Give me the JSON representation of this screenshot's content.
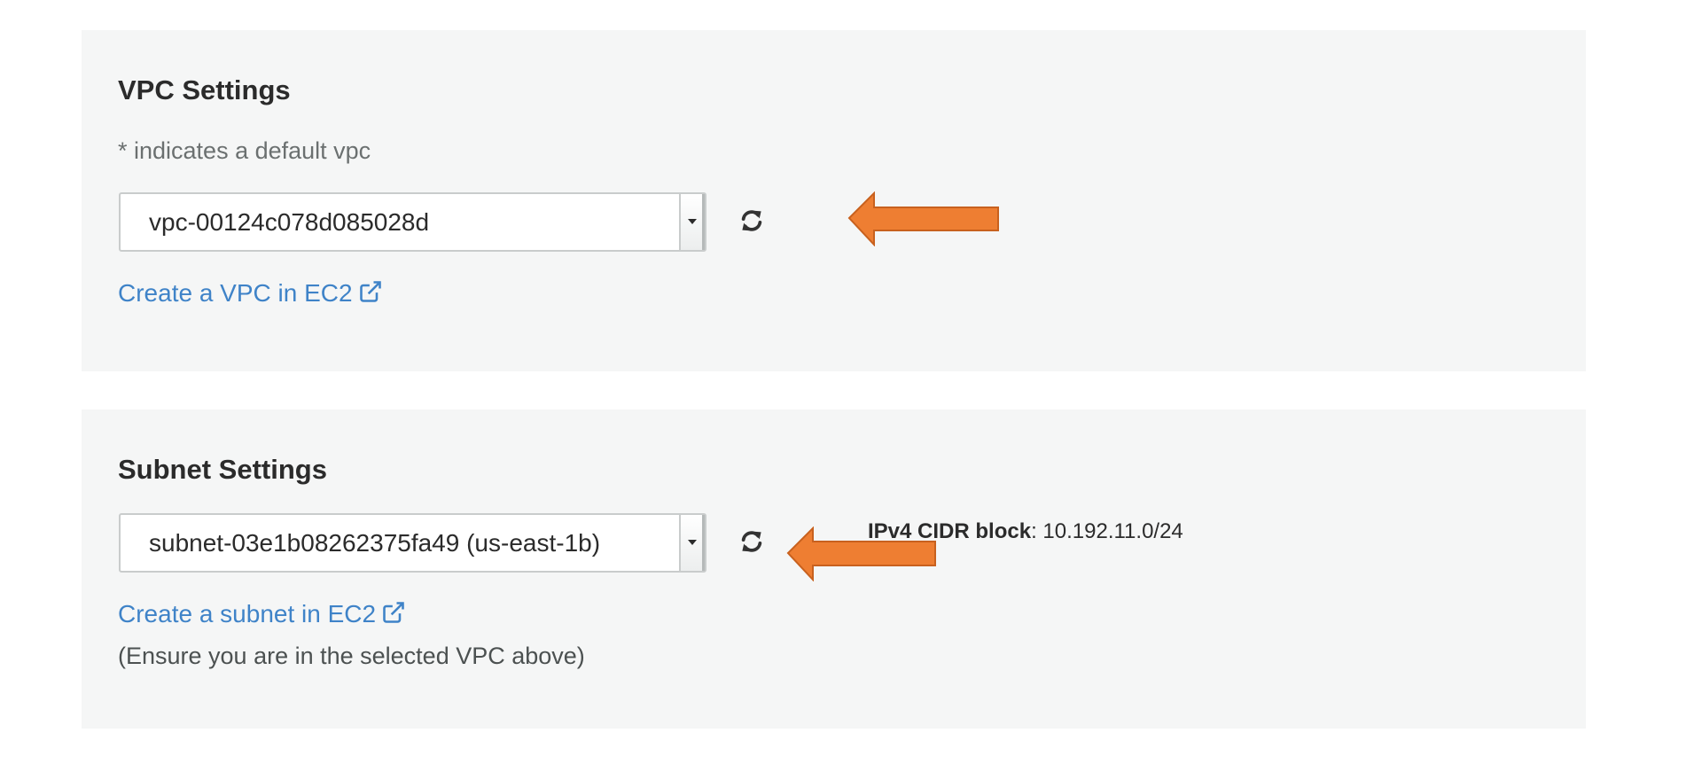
{
  "vpc_section": {
    "title": "VPC Settings",
    "hint": "* indicates a default vpc",
    "select_value": "vpc-00124c078d085028d",
    "refresh_icon": "refresh-icon",
    "create_link": "Create a VPC in EC2",
    "external_link_icon": "external-link-icon"
  },
  "subnet_section": {
    "title": "Subnet Settings",
    "select_value": "subnet-03e1b08262375fa49 (us-east-1b)",
    "refresh_icon": "refresh-icon",
    "cidr_label": "IPv4 CIDR block",
    "cidr_value": "10.192.11.0/24",
    "create_link": "Create a subnet in EC2",
    "external_link_icon": "external-link-icon",
    "note": "(Ensure you are in the selected VPC above)"
  },
  "annotations": {
    "arrow_color": "#ee7e32",
    "arrow_icon": "arrow-left-icon"
  },
  "colors": {
    "panel_background": "#f5f6f6",
    "link": "#3f83c8",
    "text": "#2b2b2b",
    "muted_text": "#6b7070"
  }
}
